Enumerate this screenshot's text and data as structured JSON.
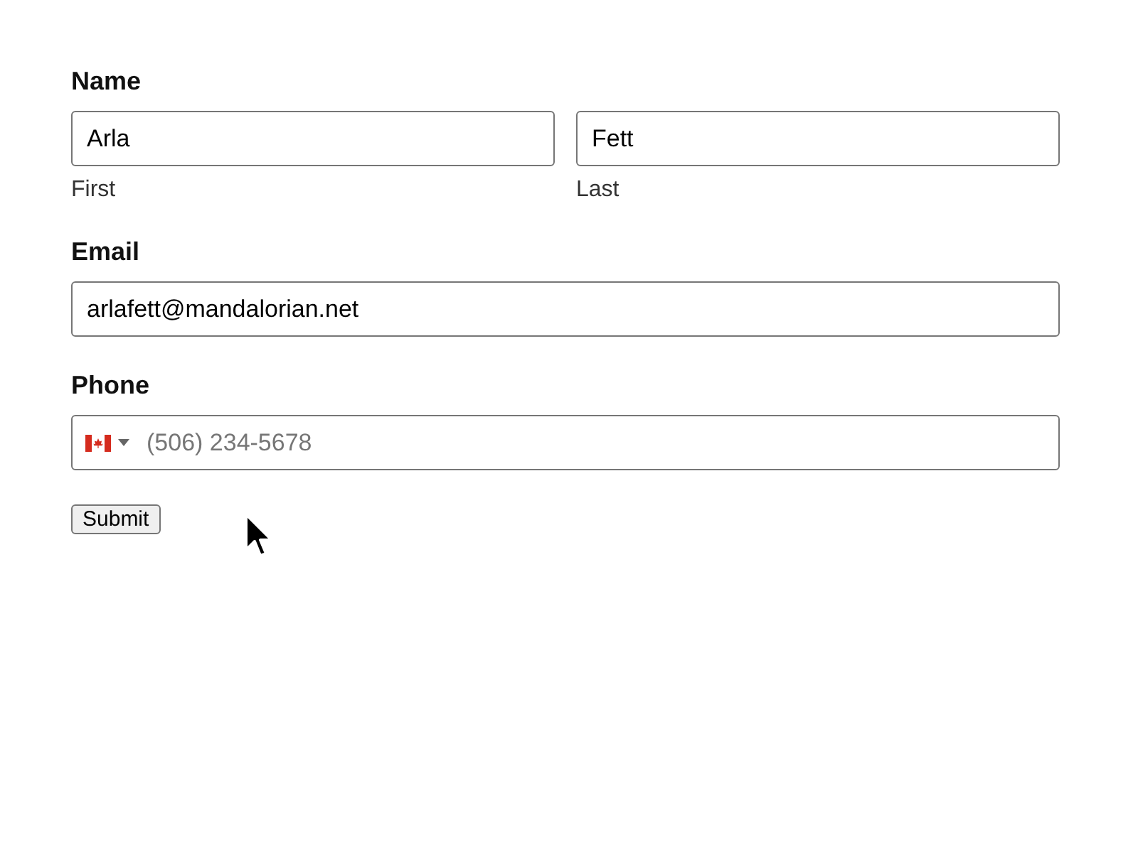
{
  "name": {
    "label": "Name",
    "fields": [
      {
        "value": "Arla",
        "sublabel": "First"
      },
      {
        "value": "Fett",
        "sublabel": "Last"
      }
    ]
  },
  "email": {
    "label": "Email",
    "value": "arlafett@mandalorian.net"
  },
  "phone": {
    "label": "Phone",
    "placeholder": "(506) 234-5678"
  },
  "submit": "Submit"
}
